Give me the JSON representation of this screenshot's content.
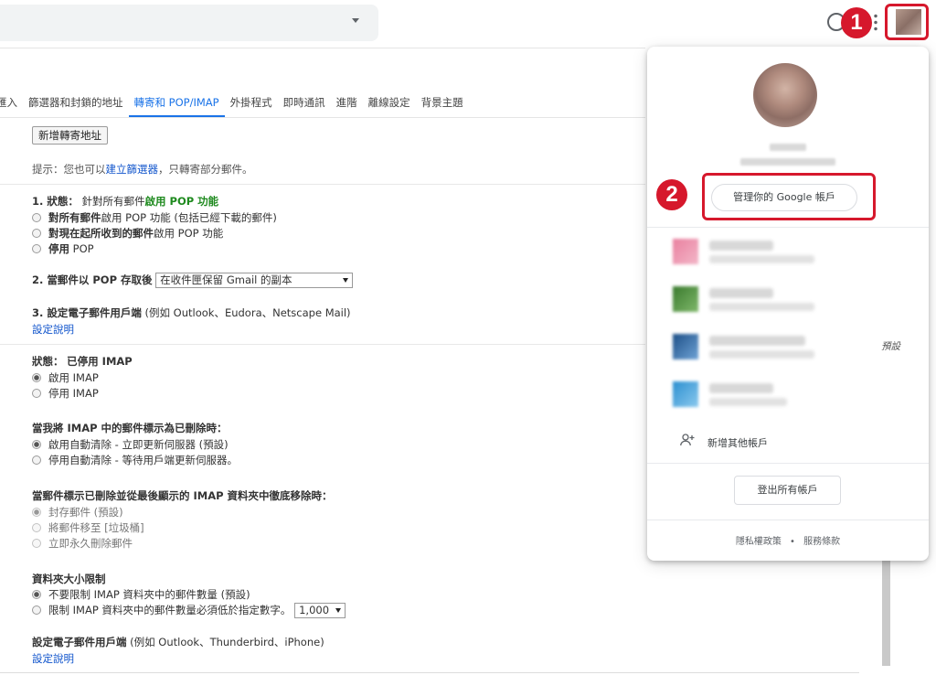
{
  "tabs": [
    "匯入",
    "篩選器和封鎖的地址",
    "轉寄和 POP/IMAP",
    "外掛程式",
    "即時通訊",
    "進階",
    "離線設定",
    "背景主題"
  ],
  "forwarding": {
    "add_button": "新增轉寄地址",
    "hint_prefix": "提示：您也可以",
    "hint_link": "建立篩選器",
    "hint_suffix": "，只轉寄部分郵件。"
  },
  "pop": {
    "status_label": "1. 狀態：",
    "status_text": "針對所有郵件",
    "status_value": "啟用 POP 功能",
    "option1_bold": "對所有郵件",
    "option1_rest": "啟用 POP 功能 (包括已經下載的郵件)",
    "option2_bold": "對現在起所收到的郵件",
    "option2_rest": "啟用 POP 功能",
    "option3_bold": "停用",
    "option3_rest": " POP",
    "when_label": "2. 當郵件以 POP 存取後",
    "when_select": "在收件匣保留 Gmail 的副本",
    "client_label": "3. 設定電子郵件用戶端",
    "client_rest": "(例如 Outlook、Eudora、Netscape Mail)",
    "client_link": "設定說明"
  },
  "imap": {
    "status_label": "狀態：",
    "status_value": "已停用 IMAP",
    "enable": "啟用 IMAP",
    "disable": "停用 IMAP",
    "delete_heading": "當我將 IMAP 中的郵件標示為已刪除時：",
    "delete_opt1": "啟用自動清除 - 立即更新伺服器 (預設)",
    "delete_opt2": "停用自動清除 - 等待用戶端更新伺服器。",
    "expunge_heading": "當郵件標示已刪除並從最後顯示的 IMAP 資料夾中徹底移除時：",
    "expunge_opt1": "封存郵件 (預設)",
    "expunge_opt2": "將郵件移至 [垃圾桶]",
    "expunge_opt3": "立即永久刪除郵件",
    "folder_heading": "資料夾大小限制",
    "folder_opt1": "不要限制 IMAP 資料夾中的郵件數量 (預設)",
    "folder_opt2": "限制 IMAP 資料夾中的郵件數量必須低於指定數字。",
    "folder_select": "1,000",
    "client_label": "設定電子郵件用戶端",
    "client_rest": "(例如 Outlook、Thunderbird、iPhone)",
    "client_link": "設定說明"
  },
  "popup": {
    "manage_button": "管理你的 Google 帳戶",
    "default_label": "預設",
    "add_account": "新增其他帳戶",
    "signout_button": "登出所有帳戶",
    "privacy": "隱私權政策",
    "dot": "•",
    "terms": "服務條款"
  },
  "badges": {
    "one": "1",
    "two": "2"
  },
  "colors": {
    "accent": "#1a73e8",
    "highlight_red": "#d6182c",
    "pop_green": "#1e8a1e",
    "link": "#1155cc"
  },
  "icons": [
    "help-icon",
    "apps-icon",
    "person-add-icon",
    "chevron-down-icon"
  ]
}
